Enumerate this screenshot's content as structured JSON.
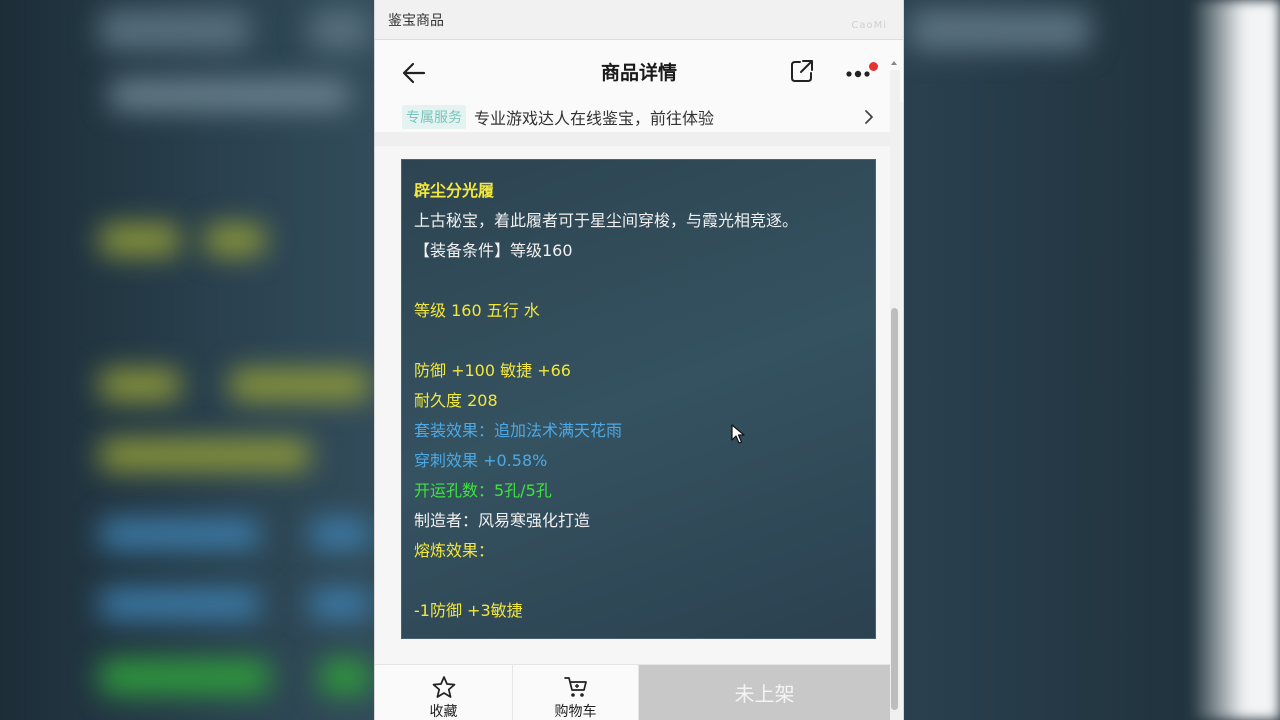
{
  "window": {
    "title": "鉴宝商品",
    "watermark": "CaoMi"
  },
  "nav": {
    "title": "商品详情",
    "back_icon": "arrow-left-icon",
    "share_icon": "share-icon",
    "more_icon": "more-dots-icon",
    "notification_dot_color": "#e8322f"
  },
  "service": {
    "tag": "专属服务",
    "text": "专业游戏达人在线鉴宝，前往体验"
  },
  "item": {
    "name": "辟尘分光履",
    "lines": [
      {
        "text": "上古秘宝，着此履者可于星尘间穿梭，与霞光相竞逐。",
        "color": "white"
      },
      {
        "text": "【装备条件】等级160",
        "color": "white"
      },
      {
        "text": "",
        "color": "blank"
      },
      {
        "text": "等级 160  五行 水",
        "color": "yellow"
      },
      {
        "text": "",
        "color": "blank"
      },
      {
        "text": "防御 +100 敏捷 +66",
        "color": "yellow"
      },
      {
        "text": "耐久度 208",
        "color": "yellow"
      },
      {
        "text": "套装效果：追加法术满天花雨",
        "color": "blue"
      },
      {
        "text": "穿刺效果 +0.58%",
        "color": "blue"
      },
      {
        "text": "开运孔数：5孔/5孔",
        "color": "green"
      },
      {
        "text": "制造者：风易寒强化打造",
        "color": "white"
      },
      {
        "text": "熔炼效果：",
        "color": "yellow"
      },
      {
        "text": "",
        "color": "blank"
      },
      {
        "text": "-1防御 +3敏捷",
        "color": "yellow"
      }
    ]
  },
  "bottom": {
    "favorite_label": "收藏",
    "cart_label": "购物车",
    "status_label": "未上架"
  },
  "colors": {
    "yellow": "#f2e73a",
    "white": "#f0f0f0",
    "blue": "#4da9e6",
    "green": "#3de43d"
  }
}
